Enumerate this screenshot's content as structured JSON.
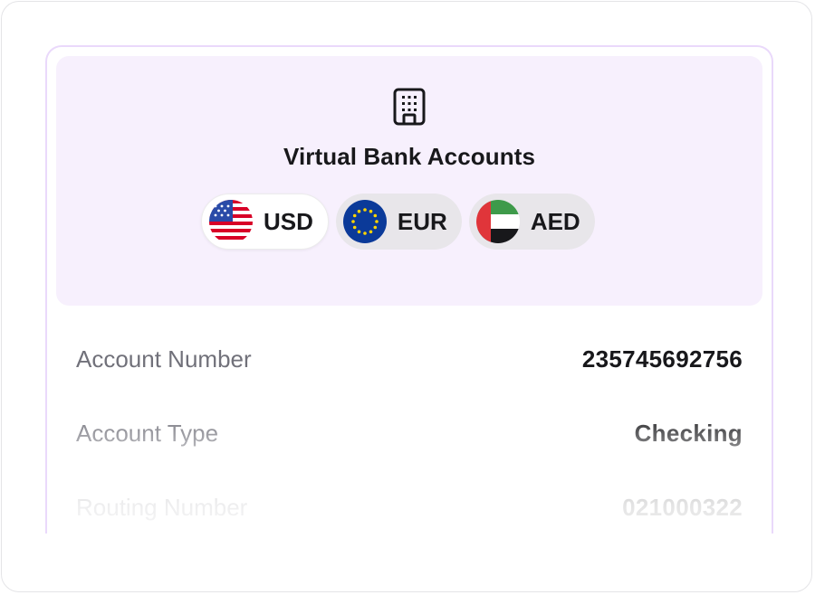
{
  "widget": {
    "title": "Virtual Bank Accounts",
    "icon": "building-icon",
    "accent_border": "#ead9fb",
    "hero_background": "#f7f0fd"
  },
  "currencies": [
    {
      "code": "USD",
      "flag": "us-flag-icon",
      "selected": true
    },
    {
      "code": "EUR",
      "flag": "eu-flag-icon",
      "selected": false
    },
    {
      "code": "AED",
      "flag": "uae-flag-icon",
      "selected": false
    }
  ],
  "details": [
    {
      "label": "Account Number",
      "value": "235745692756"
    },
    {
      "label": "Account Type",
      "value": "Checking"
    },
    {
      "label": "Routing Number",
      "value": "021000322"
    }
  ]
}
